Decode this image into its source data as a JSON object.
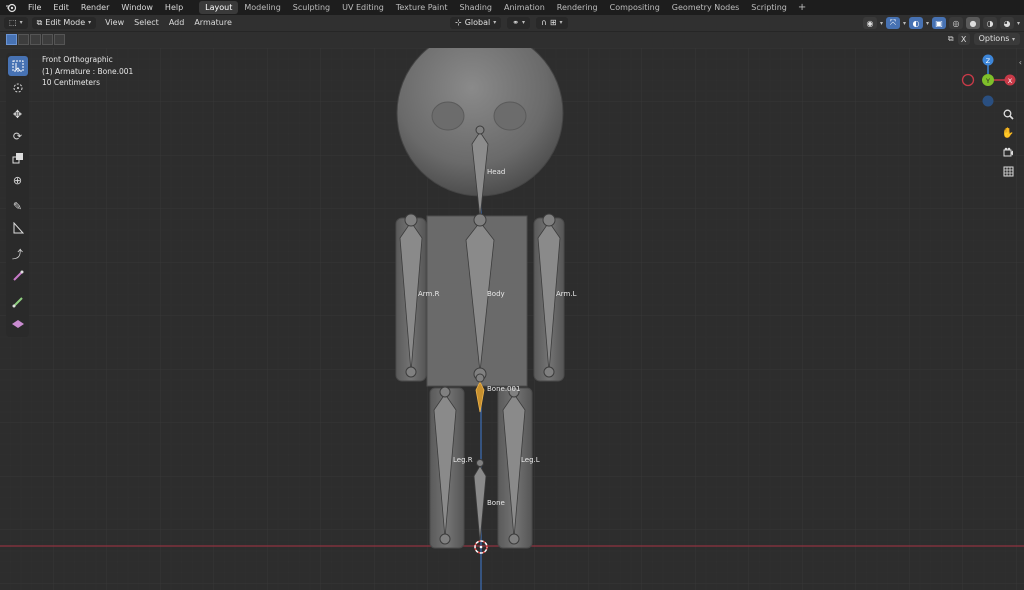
{
  "topbar": {
    "menus": [
      "File",
      "Edit",
      "Render",
      "Window",
      "Help"
    ],
    "workspaces": [
      {
        "label": "Layout",
        "active": true
      },
      {
        "label": "Modeling",
        "active": false
      },
      {
        "label": "Sculpting",
        "active": false
      },
      {
        "label": "UV Editing",
        "active": false
      },
      {
        "label": "Texture Paint",
        "active": false
      },
      {
        "label": "Shading",
        "active": false
      },
      {
        "label": "Animation",
        "active": false
      },
      {
        "label": "Rendering",
        "active": false
      },
      {
        "label": "Compositing",
        "active": false
      },
      {
        "label": "Geometry Nodes",
        "active": false
      },
      {
        "label": "Scripting",
        "active": false
      }
    ],
    "add_tab_label": "+"
  },
  "header": {
    "mode": "Edit Mode",
    "menus": [
      "View",
      "Select",
      "Add",
      "Armature"
    ],
    "transform_orientation": "Global"
  },
  "subheader": {
    "x_label": "X",
    "options_label": "Options"
  },
  "overlay": {
    "view_name": "Front Orthographic",
    "object_info": "(1) Armature : Bone.001",
    "scale_info": "10 Centimeters"
  },
  "gizmo": {
    "z_label": "Z",
    "y_label": "Y",
    "x_label": "X"
  },
  "bones": {
    "head": "Head",
    "body": "Body",
    "arm_r": "Arm.R",
    "arm_l": "Arm.L",
    "bone001": "Bone.001",
    "leg_r": "Leg.R",
    "leg_l": "Leg.L",
    "bone": "Bone"
  },
  "colors": {
    "accent": "#4772b3",
    "selected_bone": "#e0a03a",
    "x_axis": "#c83a48",
    "y_axis": "#7fbf2a",
    "z_axis": "#3d86d9",
    "mesh": "#6e6e6e",
    "grid": "#333333"
  },
  "icons": {
    "toolbar": [
      "select-box-icon",
      "cursor-icon",
      "move-icon",
      "rotate-icon",
      "scale-icon",
      "transform-icon",
      "annotate-icon",
      "measure-icon",
      "extrude-icon",
      "bone-size-icon",
      "roll-icon",
      "envelope-icon"
    ],
    "nav": [
      "zoom-icon",
      "pan-hand-icon",
      "camera-icon",
      "grid-icon"
    ]
  }
}
